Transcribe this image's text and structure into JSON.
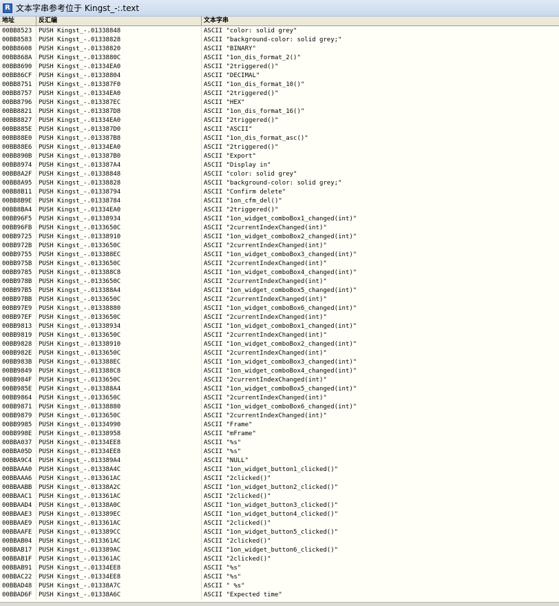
{
  "window": {
    "title": "文本字串参考位于 Kingst_-:.text",
    "icon_label": "R",
    "icon": "olly-r-icon"
  },
  "columns": [
    "地址",
    "反汇编",
    "文本字串"
  ],
  "rows": [
    [
      "00BB8523",
      "PUSH Kingst_-.01338848",
      "ASCII \"color: solid grey\""
    ],
    [
      "00BB8583",
      "PUSH Kingst_-.01338828",
      "ASCII \"background-color: solid grey;\""
    ],
    [
      "00BB8608",
      "PUSH Kingst_-.01338820",
      "ASCII \"BINARY\""
    ],
    [
      "00BB868A",
      "PUSH Kingst_-.0133880C",
      "ASCII \"1on_dis_format_2()\""
    ],
    [
      "00BB8690",
      "PUSH Kingst_-.01334EA0",
      "ASCII \"2triggered()\""
    ],
    [
      "00BB86CF",
      "PUSH Kingst_-.01338804",
      "ASCII \"DECIMAL\""
    ],
    [
      "00BB8751",
      "PUSH Kingst_-.013387F0",
      "ASCII \"1on_dis_format_10()\""
    ],
    [
      "00BB8757",
      "PUSH Kingst_-.01334EA0",
      "ASCII \"2triggered()\""
    ],
    [
      "00BB8796",
      "PUSH Kingst_-.013387EC",
      "ASCII \"HEX\""
    ],
    [
      "00BB8821",
      "PUSH Kingst_-.013387D8",
      "ASCII \"1on_dis_format_16()\""
    ],
    [
      "00BB8827",
      "PUSH Kingst_-.01334EA0",
      "ASCII \"2triggered()\""
    ],
    [
      "00BB885E",
      "PUSH Kingst_-.013387D0",
      "ASCII \"ASCII\""
    ],
    [
      "00BB88E0",
      "PUSH Kingst_-.013387B8",
      "ASCII \"1on_dis_format_asc()\""
    ],
    [
      "00BB88E6",
      "PUSH Kingst_-.01334EA0",
      "ASCII \"2triggered()\""
    ],
    [
      "00BB890B",
      "PUSH Kingst_-.013387B0",
      "ASCII \"Export\""
    ],
    [
      "00BB8974",
      "PUSH Kingst_-.013387A4",
      "ASCII \"Display in\""
    ],
    [
      "00BB8A2F",
      "PUSH Kingst_-.01338848",
      "ASCII \"color: solid grey\""
    ],
    [
      "00BB8A95",
      "PUSH Kingst_-.01338828",
      "ASCII \"background-color: solid grey;\""
    ],
    [
      "00BB8B11",
      "PUSH Kingst_-.01338794",
      "ASCII \"Confirm delete\""
    ],
    [
      "00BB8B9E",
      "PUSH Kingst_-.01338784",
      "ASCII \"1on_cfm_del()\""
    ],
    [
      "00BB8BA4",
      "PUSH Kingst_-.01334EA0",
      "ASCII \"2triggered()\""
    ],
    [
      "00BB96F5",
      "PUSH Kingst_-.01338934",
      "ASCII \"1on_widget_comboBox1_changed(int)\""
    ],
    [
      "00BB96FB",
      "PUSH Kingst_-.0133650C",
      "ASCII \"2currentIndexChanged(int)\""
    ],
    [
      "00BB9725",
      "PUSH Kingst_-.01338910",
      "ASCII \"1on_widget_comboBox2_changed(int)\""
    ],
    [
      "00BB972B",
      "PUSH Kingst_-.0133650C",
      "ASCII \"2currentIndexChanged(int)\""
    ],
    [
      "00BB9755",
      "PUSH Kingst_-.013388EC",
      "ASCII \"1on_widget_comboBox3_changed(int)\""
    ],
    [
      "00BB975B",
      "PUSH Kingst_-.0133650C",
      "ASCII \"2currentIndexChanged(int)\""
    ],
    [
      "00BB9785",
      "PUSH Kingst_-.013388C8",
      "ASCII \"1on_widget_comboBox4_changed(int)\""
    ],
    [
      "00BB978B",
      "PUSH Kingst_-.0133650C",
      "ASCII \"2currentIndexChanged(int)\""
    ],
    [
      "00BB97B5",
      "PUSH Kingst_-.013388A4",
      "ASCII \"1on_widget_comboBox5_changed(int)\""
    ],
    [
      "00BB97BB",
      "PUSH Kingst_-.0133650C",
      "ASCII \"2currentIndexChanged(int)\""
    ],
    [
      "00BB97E9",
      "PUSH Kingst_-.01338880",
      "ASCII \"1on_widget_comboBox6_changed(int)\""
    ],
    [
      "00BB97EF",
      "PUSH Kingst_-.0133650C",
      "ASCII \"2currentIndexChanged(int)\""
    ],
    [
      "00BB9813",
      "PUSH Kingst_-.01338934",
      "ASCII \"1on_widget_comboBox1_changed(int)\""
    ],
    [
      "00BB9819",
      "PUSH Kingst_-.0133650C",
      "ASCII \"2currentIndexChanged(int)\""
    ],
    [
      "00BB9828",
      "PUSH Kingst_-.01338910",
      "ASCII \"1on_widget_comboBox2_changed(int)\""
    ],
    [
      "00BB982E",
      "PUSH Kingst_-.0133650C",
      "ASCII \"2currentIndexChanged(int)\""
    ],
    [
      "00BB983B",
      "PUSH Kingst_-.013388EC",
      "ASCII \"1on_widget_comboBox3_changed(int)\""
    ],
    [
      "00BB9849",
      "PUSH Kingst_-.013388C8",
      "ASCII \"1on_widget_comboBox4_changed(int)\""
    ],
    [
      "00BB984F",
      "PUSH Kingst_-.0133650C",
      "ASCII \"2currentIndexChanged(int)\""
    ],
    [
      "00BB985E",
      "PUSH Kingst_-.013388A4",
      "ASCII \"1on_widget_comboBox5_changed(int)\""
    ],
    [
      "00BB9864",
      "PUSH Kingst_-.0133650C",
      "ASCII \"2currentIndexChanged(int)\""
    ],
    [
      "00BB9871",
      "PUSH Kingst_-.01338880",
      "ASCII \"1on_widget_comboBox6_changed(int)\""
    ],
    [
      "00BB9879",
      "PUSH Kingst_-.0133650C",
      "ASCII \"2currentIndexChanged(int)\""
    ],
    [
      "00BB9985",
      "PUSH Kingst_-.01334990",
      "ASCII \"Frame\""
    ],
    [
      "00BB998E",
      "PUSH Kingst_-.01338958",
      "ASCII \"mFrame\""
    ],
    [
      "00BBA037",
      "PUSH Kingst_-.01334EE8",
      "ASCII \"%s\""
    ],
    [
      "00BBA05D",
      "PUSH Kingst_-.01334EE8",
      "ASCII \"%s\""
    ],
    [
      "00BBA9C4",
      "PUSH Kingst_-.013389A4",
      "ASCII \"NULL\""
    ],
    [
      "00BBAAA0",
      "PUSH Kingst_-.01338A4C",
      "ASCII \"1on_widget_button1_clicked()\""
    ],
    [
      "00BBAAA6",
      "PUSH Kingst_-.013361AC",
      "ASCII \"2clicked()\""
    ],
    [
      "00BBAABB",
      "PUSH Kingst_-.01338A2C",
      "ASCII \"1on_widget_button2_clicked()\""
    ],
    [
      "00BBAAC1",
      "PUSH Kingst_-.013361AC",
      "ASCII \"2clicked()\""
    ],
    [
      "00BBAAD4",
      "PUSH Kingst_-.01338A0C",
      "ASCII \"1on_widget_button3_clicked()\""
    ],
    [
      "00BBAAE3",
      "PUSH Kingst_-.013389EC",
      "ASCII \"1on_widget_button4_clicked()\""
    ],
    [
      "00BBAAE9",
      "PUSH Kingst_-.013361AC",
      "ASCII \"2clicked()\""
    ],
    [
      "00BBAAFE",
      "PUSH Kingst_-.013389CC",
      "ASCII \"1on_widget_button5_clicked()\""
    ],
    [
      "00BBAB04",
      "PUSH Kingst_-.013361AC",
      "ASCII \"2clicked()\""
    ],
    [
      "00BBAB17",
      "PUSH Kingst_-.013389AC",
      "ASCII \"1on_widget_button6_clicked()\""
    ],
    [
      "00BBAB1F",
      "PUSH Kingst_-.013361AC",
      "ASCII \"2clicked()\""
    ],
    [
      "00BBAB91",
      "PUSH Kingst_-.01334EE8",
      "ASCII \"%s\""
    ],
    [
      "00BBAC22",
      "PUSH Kingst_-.01334EE8",
      "ASCII \"%s\""
    ],
    [
      "00BBAD48",
      "PUSH Kingst_-.01338A7C",
      "ASCII \" %s\""
    ],
    [
      "00BBAD6F",
      "PUSH Kingst_-.01338A6C",
      "ASCII \"Expected time\""
    ]
  ]
}
